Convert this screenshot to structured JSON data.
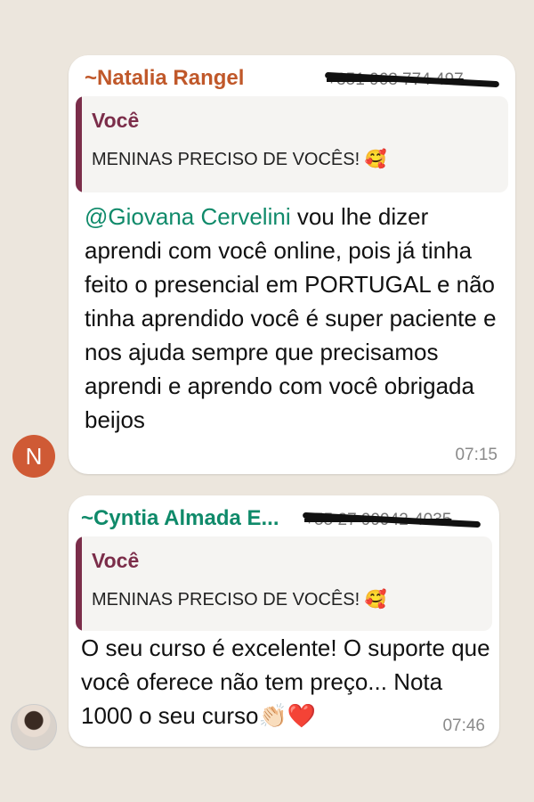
{
  "messages": [
    {
      "sender": "~Natalia Rangel",
      "phone": "+351 963 774 497",
      "quote_author": "Você",
      "quote_text": "MENINAS PRECISO DE VOCÊS! 🥰",
      "mention": "@Giovana Cervelini",
      "text": " vou lhe dizer aprendi com você online, pois já tinha feito o presencial em PORTUGAL e não tinha aprendido você é super paciente e nos ajuda sempre que precisamos aprendi e aprendo com você obrigada beijos",
      "time": "07:15",
      "avatar_initial": "N"
    },
    {
      "sender": "~Cyntia Almada E...",
      "phone": "+55 27 99942-4035",
      "quote_author": "Você",
      "quote_text": "MENINAS PRECISO DE VOCÊS! 🥰",
      "text": "O seu curso é excelente! O suporte que você oferece não tem preço... Nota 1000 o seu curso👏🏻❤️",
      "time": "07:46"
    }
  ],
  "colors": {
    "sender1": "#c0582a",
    "sender2": "#0f8a6a",
    "quote_bar": "#7b2d4a",
    "avatar_n": "#cf5a35"
  }
}
